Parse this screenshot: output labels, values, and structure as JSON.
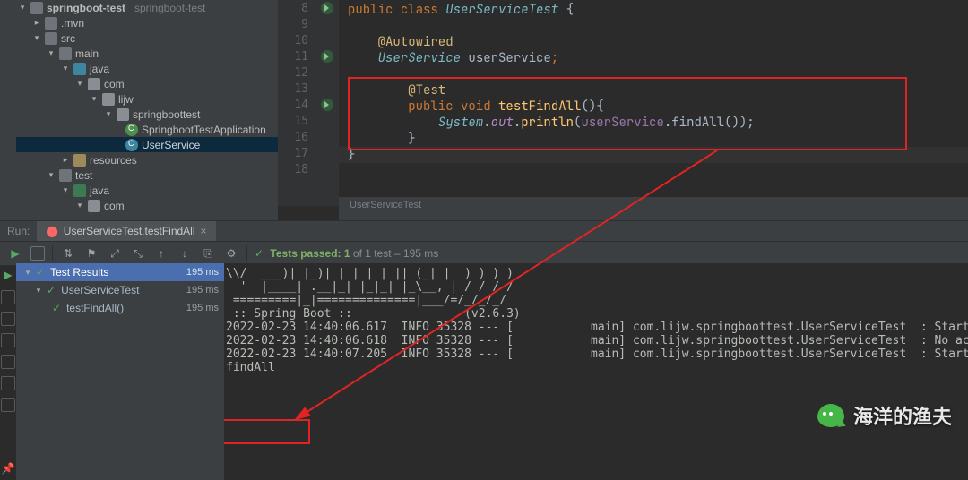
{
  "tree": {
    "project": "springboot-test",
    "project_dim": "springboot-test",
    "mvn": ".mvn",
    "src": "src",
    "main": "main",
    "java1": "java",
    "com1": "com",
    "lijw": "lijw",
    "springboottest": "springboottest",
    "app": "SpringbootTestApplication",
    "svc": "UserService",
    "resources": "resources",
    "test": "test",
    "java2": "java",
    "com2": "com"
  },
  "code": {
    "l8": "public class UserServiceTest {",
    "l9": "",
    "l10": "    @Autowired",
    "l11": "    UserService userService;",
    "l12": "",
    "l13": "        @Test",
    "l14": "        public void testFindAll(){",
    "l15": "            System.out.println(userService.findAll());",
    "l16": "        }",
    "l17": "}",
    "l18": ""
  },
  "lines": {
    "n8": "8",
    "n9": "9",
    "n10": "10",
    "n11": "11",
    "n12": "12",
    "n13": "13",
    "n14": "14",
    "n15": "15",
    "n16": "16",
    "n17": "17",
    "n18": "18"
  },
  "breadcrumb": "UserServiceTest",
  "run": {
    "label": "Run:",
    "tab": "UserServiceTest.testFindAll",
    "passed_prefix": "Tests passed: 1",
    "passed_suffix": " of 1 test – 195 ms",
    "tree_root": "Test Results",
    "tree_class": "UserServiceTest",
    "tree_method": "testFindAll()",
    "t_root": "195 ms",
    "t_class": "195 ms",
    "t_method": "195 ms"
  },
  "console": {
    "banner1": "\\\\/  ___)| |_)| | | | | || (_| |  ) ) ) )",
    "banner2": "  '  |____| .__|_| |_|_| |_\\__, | / / / /",
    "banner3": " =========|_|==============|___/=/_/_/_/",
    "banner4": " :: Spring Boot ::                (v2.6.3)",
    "log1": "2022-02-23 14:40:06.617  INFO 35328 --- [           main] com.lijw.springboottest.UserServiceTest  : Starting",
    "log2": "2022-02-23 14:40:06.618  INFO 35328 --- [           main] com.lijw.springboottest.UserServiceTest  : No activ",
    "log3": "2022-02-23 14:40:07.205  INFO 35328 --- [           main] com.lijw.springboottest.UserServiceTest  : Started ",
    "out": "findAll"
  },
  "watermark": "海洋的渔夫"
}
